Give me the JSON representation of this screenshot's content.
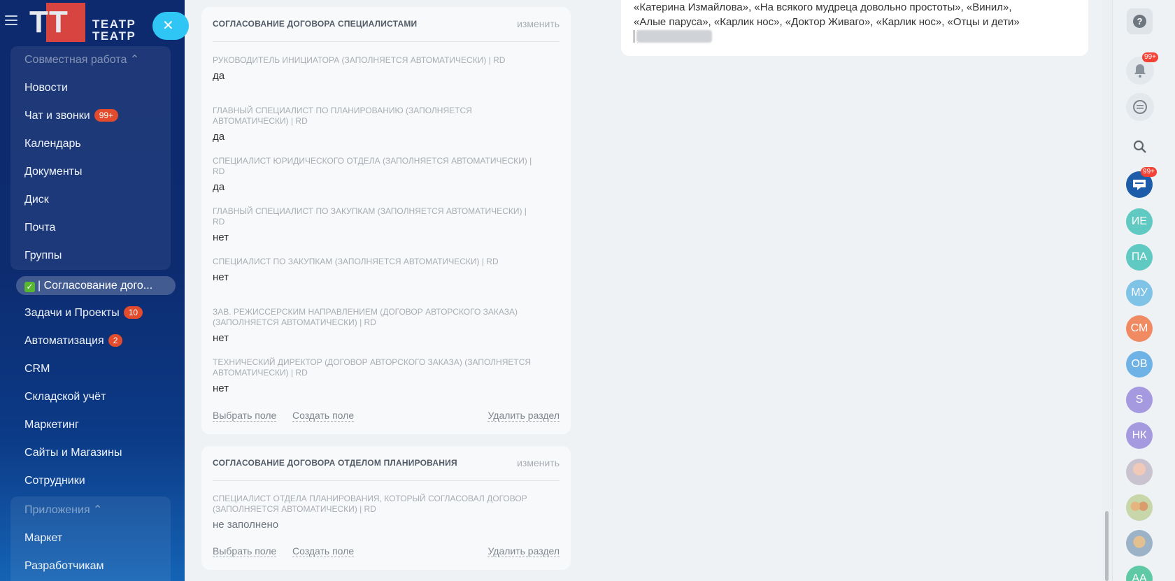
{
  "sidebar": {
    "logo": {
      "top": "ТЕАТР",
      "bottom": "ТЕАТР"
    },
    "collab_header": "Совместная работа ⌃",
    "collab_items": [
      {
        "label": "Новости",
        "badge": ""
      },
      {
        "label": "Чат и звонки",
        "badge": "99+"
      },
      {
        "label": "Календарь",
        "badge": ""
      },
      {
        "label": "Документы",
        "badge": ""
      },
      {
        "label": "Диск",
        "badge": ""
      },
      {
        "label": "Почта",
        "badge": ""
      },
      {
        "label": "Группы",
        "badge": ""
      }
    ],
    "active_item": "| Согласование дого...",
    "items": [
      {
        "label": "Задачи и Проекты",
        "badge": "10"
      },
      {
        "label": "Автоматизация",
        "badge": "2"
      },
      {
        "label": "CRM",
        "badge": ""
      },
      {
        "label": "Складской учёт",
        "badge": ""
      },
      {
        "label": "Маркетинг",
        "badge": ""
      },
      {
        "label": "Сайты и Магазины",
        "badge": ""
      },
      {
        "label": "Сотрудники",
        "badge": ""
      }
    ],
    "apps_header": "Приложения ⌃",
    "apps_items": [
      {
        "label": "Маркет"
      },
      {
        "label": "Разработчикам"
      }
    ]
  },
  "card1": {
    "title": "СОГЛАСОВАНИЕ ДОГОВОРА СПЕЦИАЛИСТАМИ",
    "edit": "изменить",
    "fields": [
      {
        "label": "РУКОВОДИТЕЛЬ ИНИЦИАТОРА (ЗАПОЛНЯЕТСЯ АВТОМАТИЧЕСКИ) | RD",
        "value": "да"
      },
      {
        "label": "ГЛАВНЫЙ СПЕЦИАЛИСТ ПО ПЛАНИРОВАНИЮ (ЗАПОЛНЯЕТСЯ АВТОМАТИЧЕСКИ) | RD",
        "value": "да"
      },
      {
        "label": "СПЕЦИАЛИСТ ЮРИДИЧЕСКОГО ОТДЕЛА (ЗАПОЛНЯЕТСЯ АВТОМАТИЧЕСКИ) | RD",
        "value": "да"
      },
      {
        "label": "ГЛАВНЫЙ СПЕЦИАЛИСТ ПО ЗАКУПКАМ (ЗАПОЛНЯЕТСЯ АВТОМАТИЧЕСКИ) | RD",
        "value": "нет"
      },
      {
        "label": "СПЕЦИАЛИСТ ПО ЗАКУПКАМ (ЗАПОЛНЯЕТСЯ АВТОМАТИЧЕСКИ) | RD",
        "value": "нет"
      },
      {
        "label": "ЗАВ. РЕЖИССЕРСКИМ НАПРАВЛЕНИЕМ (ДОГОВОР АВТОРСКОГО ЗАКАЗА) (ЗАПОЛНЯЕТСЯ АВТОМАТИЧЕСКИ) | RD",
        "value": "нет"
      },
      {
        "label": "ТЕХНИЧЕСКИЙ ДИРЕКТОР (ДОГОВОР АВТОРСКОГО ЗАКАЗА) (ЗАПОЛНЯЕТСЯ АВТОМАТИЧЕСКИ) | RD",
        "value": "нет"
      }
    ],
    "links": {
      "select": "Выбрать поле",
      "create": "Создать поле",
      "delete": "Удалить раздел"
    }
  },
  "card2": {
    "title": "СОГЛАСОВАНИЕ ДОГОВОРА ОТДЕЛОМ ПЛАНИРОВАНИЯ",
    "edit": "изменить",
    "fields": [
      {
        "label": "СПЕЦИАЛИСТ ОТДЕЛА ПЛАНИРОВАНИЯ, КОТОРЫЙ СОГЛАСОВАЛ ДОГОВОР (ЗАПОЛНЯЕТСЯ АВТОМАТИЧЕСКИ) | RD",
        "value": "не заполнено"
      }
    ],
    "links": {
      "select": "Выбрать поле",
      "create": "Создать поле",
      "delete": "Удалить раздел"
    }
  },
  "text_card": {
    "line1": "«Катерина Измайлова», «На всякого мудреца довольно простоты», «Винил»,",
    "line2": "«Алые паруса», «Карлик нос», «Доктор Живаго», «Карлик нос», «Отцы и дети»"
  },
  "rail": {
    "notif_badge": "99+",
    "chat_badge": "99+",
    "avatars": [
      {
        "initials": "ИЕ",
        "color": "#5fc9c2"
      },
      {
        "initials": "ПА",
        "color": "#5fc9c2"
      },
      {
        "initials": "МУ",
        "color": "#7fc3e6"
      },
      {
        "initials": "СМ",
        "color": "#ef8a63"
      },
      {
        "initials": "ОВ",
        "color": "#6fb2e6"
      },
      {
        "initials": "S",
        "color": "#a59ae0"
      },
      {
        "initials": "НК",
        "color": "#a59ae0"
      },
      {
        "initials": "АА",
        "color": "#5fc9a5"
      }
    ]
  }
}
